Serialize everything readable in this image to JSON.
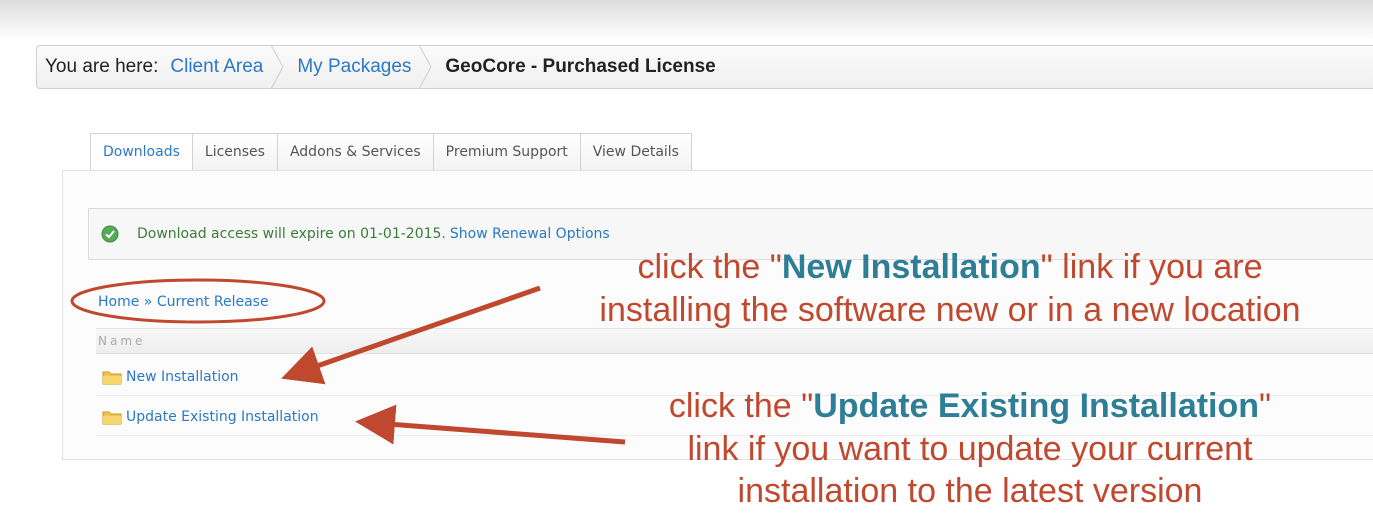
{
  "breadcrumb": {
    "prefix": "You are here:",
    "items": [
      {
        "label": "Client Area"
      },
      {
        "label": "My Packages"
      }
    ],
    "current": "GeoCore - Purchased License"
  },
  "tabs": [
    {
      "label": "Downloads",
      "active": true
    },
    {
      "label": "Licenses"
    },
    {
      "label": "Addons & Services"
    },
    {
      "label": "Premium Support"
    },
    {
      "label": "View Details"
    }
  ],
  "notice": {
    "text": "Download access will expire on 01-01-2015.",
    "link": "Show Renewal Options",
    "icon": "check-circle-icon",
    "color": "#3b7d3b"
  },
  "file_breadcrumb": {
    "home": "Home",
    "separator": "»",
    "current": "Current Release"
  },
  "table": {
    "header": "Name",
    "rows": [
      {
        "label": "New Installation",
        "icon": "folder-icon"
      },
      {
        "label": "Update Existing Installation",
        "icon": "folder-icon"
      }
    ]
  },
  "annotations": {
    "a1": {
      "pre": "click the \"",
      "highlight": "New Installation",
      "post": "\" link if you are",
      "line2": "installing the software new or in a new location"
    },
    "a2": {
      "pre": "click the \"",
      "highlight": "Update Existing Installation",
      "post": "\"",
      "line2": "link if you want to update your current",
      "line3": "installation to the latest version"
    },
    "color": "#c0482e",
    "highlight_color": "#2e7f96"
  },
  "colors": {
    "link": "#2b78c5"
  }
}
